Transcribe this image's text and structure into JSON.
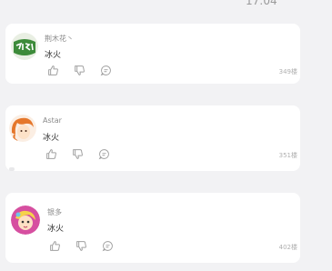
{
  "status_bar": {
    "time": "17:04"
  },
  "comments": [
    {
      "username": "荆木花丶",
      "text": "冰火",
      "floor": "349楼",
      "avatar_icon": "green-logo-avatar"
    },
    {
      "username": "Astar",
      "text": "冰火",
      "floor": "351楼",
      "avatar_icon": "anime-girl-avatar"
    },
    {
      "username": "银多",
      "text": "冰火",
      "floor": "402楼",
      "avatar_icon": "cartoon-girl-avatar"
    }
  ],
  "colors": {
    "background": "#f2f2f4",
    "card": "#ffffff",
    "icon": "#a0a0a0"
  }
}
